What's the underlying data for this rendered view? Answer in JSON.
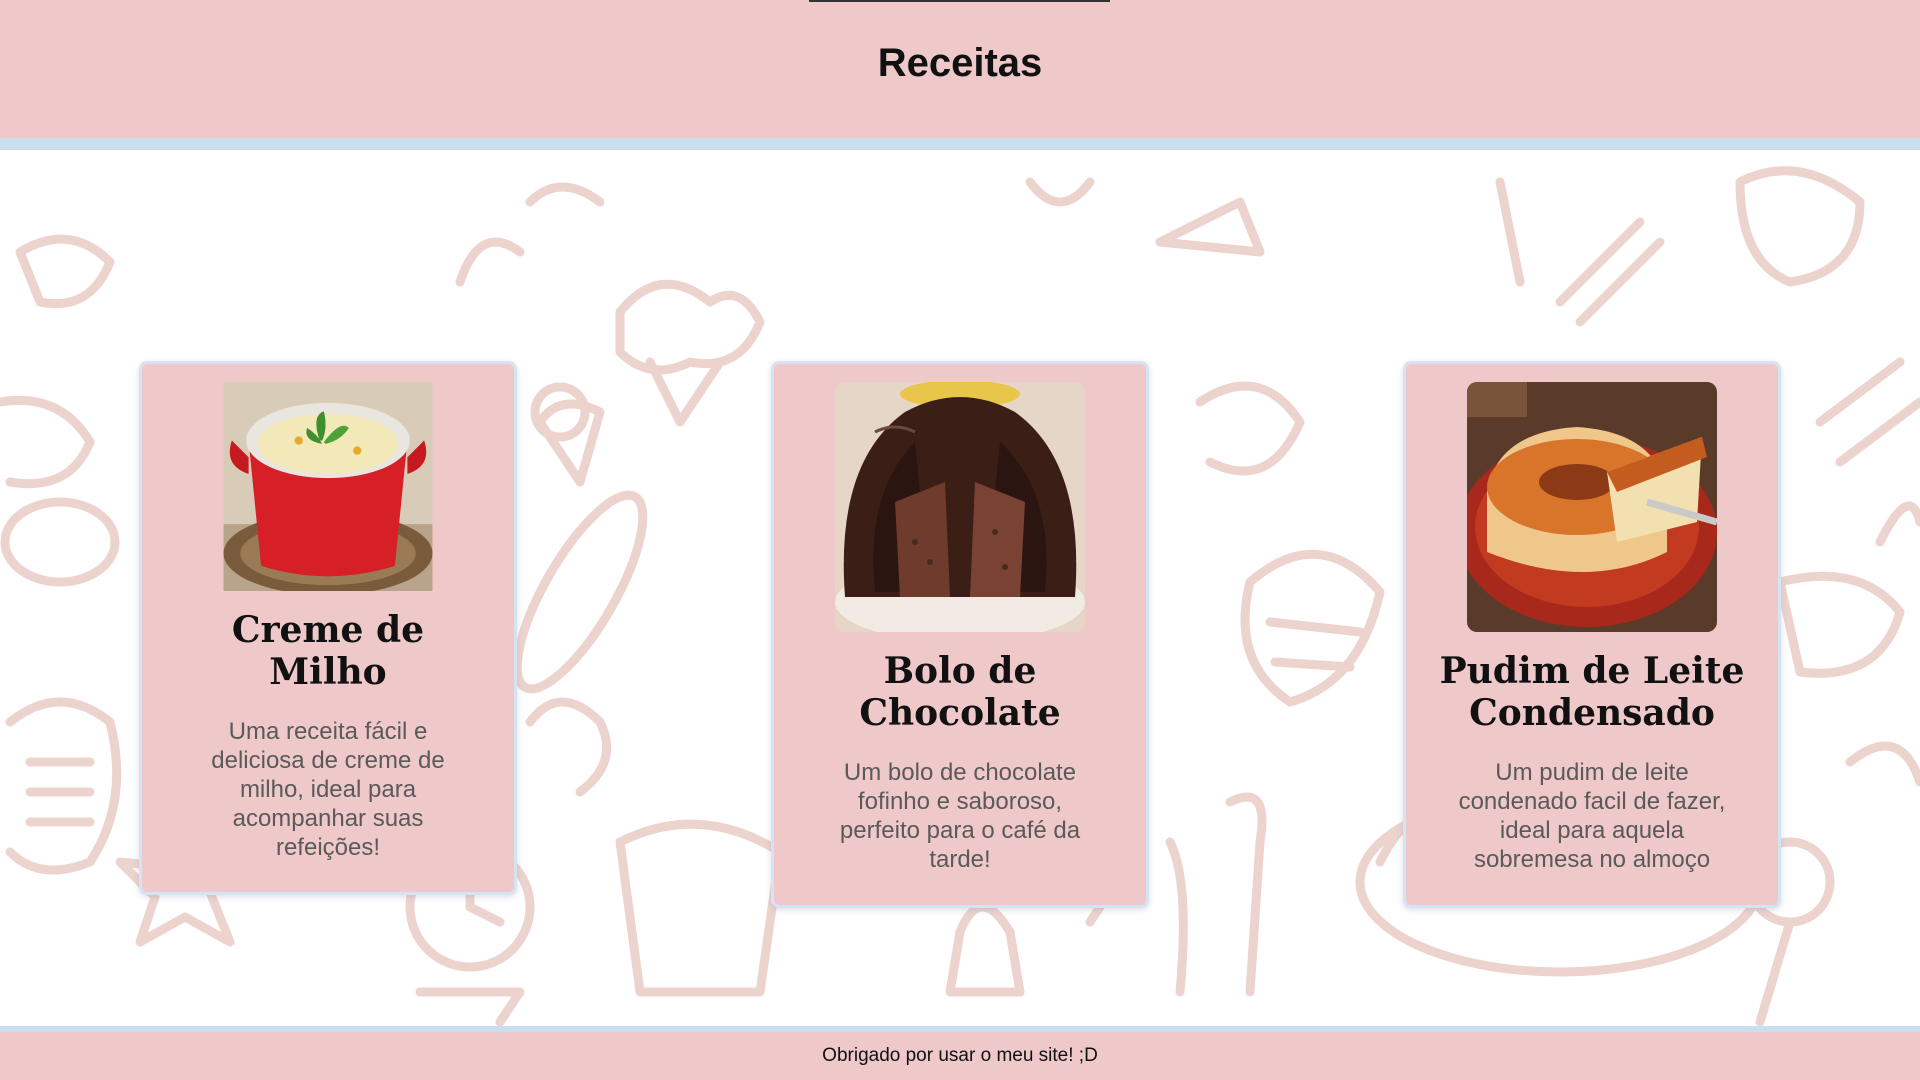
{
  "header": {
    "title": "Receitas"
  },
  "recipes": [
    {
      "title": "Creme de Milho",
      "description": "Uma receita fácil e deliciosa de creme de milho, ideal para acompanhar suas refeições!",
      "image": "pot-of-corn-cream"
    },
    {
      "title": "Bolo de Chocolate",
      "description": "Um bolo de chocolate fofinho e saboroso, perfeito para o café da tarde!",
      "image": "chocolate-bundt-cake"
    },
    {
      "title": "Pudim de Leite Condensado",
      "description": "Um pudim de leite condenado facil de fazer, ideal para aquela sobremesa no almoço",
      "image": "caramel-flan"
    }
  ],
  "footer": {
    "text": "Obrigado por usar o meu site! ;D"
  },
  "colors": {
    "pink": "#efc8c9",
    "blue_border": "#c9def1",
    "doodle": "#ecd3cd"
  }
}
